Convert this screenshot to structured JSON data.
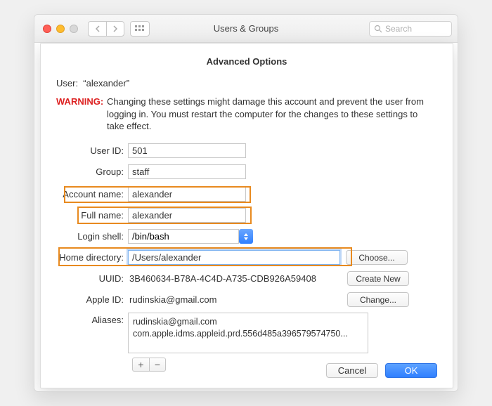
{
  "titlebar": {
    "window_title": "Users & Groups",
    "search_placeholder": "Search"
  },
  "sheet": {
    "title": "Advanced Options",
    "user_prefix": "User:",
    "user_value": "“alexander”",
    "warning_label": "WARNING:",
    "warning_text": "Changing these settings might damage this account and prevent the user from logging in. You must restart the computer for the changes to these settings to take effect."
  },
  "labels": {
    "user_id": "User ID:",
    "group": "Group:",
    "account_name": "Account name:",
    "full_name": "Full name:",
    "login_shell": "Login shell:",
    "home_directory": "Home directory:",
    "uuid": "UUID:",
    "apple_id": "Apple ID:",
    "aliases": "Aliases:"
  },
  "values": {
    "user_id": "501",
    "group": "staff",
    "account_name": "alexander",
    "full_name": "alexander",
    "login_shell": "/bin/bash",
    "home_directory": "/Users/alexander",
    "uuid": "3B460634-B78A-4C4D-A735-CDB926A59408",
    "apple_id": "rudinskia@gmail.com",
    "aliases_line1": "rudinskia@gmail.com",
    "aliases_line2": "com.apple.idms.appleid.prd.556d485a396579574750..."
  },
  "buttons": {
    "choose": "Choose...",
    "create_new": "Create New",
    "change": "Change...",
    "cancel": "Cancel",
    "ok": "OK"
  }
}
